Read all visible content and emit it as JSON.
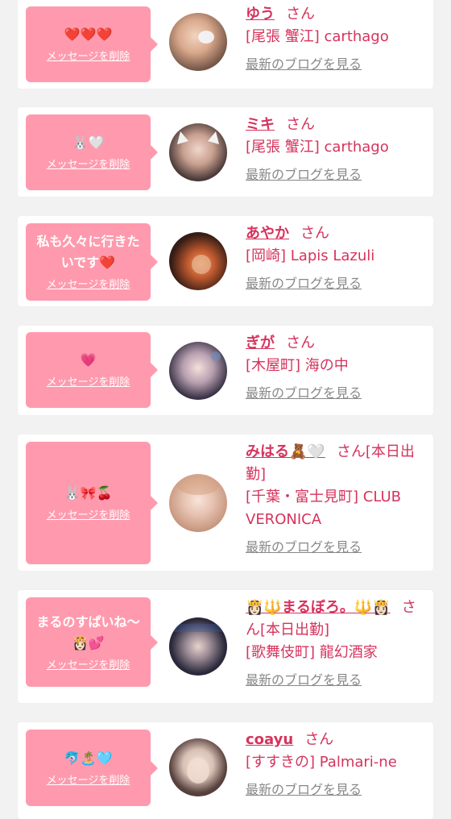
{
  "colors": {
    "accent": "#d6335c",
    "bubble": "#ff9aae",
    "background": "#f2f2f2",
    "link_gray": "#888888"
  },
  "labels": {
    "delete": "メッセージを削除",
    "blog": "最新のブログを見る",
    "san": "さん"
  },
  "items": [
    {
      "message": "❤️❤️❤️",
      "name": "ゆう",
      "suffix": "",
      "shop": "[尾張 蟹江] carthago"
    },
    {
      "message": "🐰🤍",
      "name": "ミキ",
      "suffix": "",
      "shop": "[尾張 蟹江] carthago"
    },
    {
      "message": "私も久々に行きたいです❤️",
      "name": "あやか",
      "suffix": "",
      "shop": "[岡崎] Lapis Lazuli"
    },
    {
      "message": "💗",
      "name": "ぎが",
      "suffix": "",
      "shop": "[木屋町] 海の中"
    },
    {
      "message": "🐰🎀🍒",
      "name": "みはる🧸🤍",
      "suffix": "[本日出勤]",
      "shop": "[千葉・富士見町] CLUB VERONICA"
    },
    {
      "message": "まるのすぱいね〜👸🏻💕",
      "name": "👸🏻🔱まるぼろ。🔱👸🏻",
      "suffix": "[本日出勤]",
      "shop": "[歌舞伎町] 龍幻酒家"
    },
    {
      "message": "🐬🏝️🩵",
      "name": "coayu",
      "suffix": "",
      "shop": "[すすきの] Palmari-ne"
    }
  ]
}
